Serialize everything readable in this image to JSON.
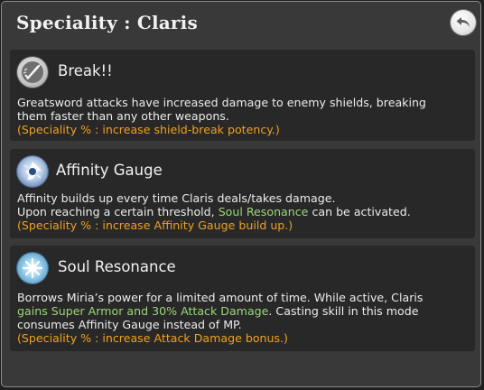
{
  "header": {
    "title": "Speciality : Claris",
    "back_icon": "undo-arrow-icon"
  },
  "skills": [
    {
      "name": "Break!!",
      "icon": "sword-strike-icon",
      "desc_line1": "Greatsword attacks have increased damage to enemy shields, breaking",
      "desc_line2": "them faster than any other weapons.",
      "bonus": "(Speciality % : increase shield-break potency.)"
    },
    {
      "name": "Affinity Gauge",
      "icon": "affinity-spirit-icon",
      "desc_line1": "Affinity builds up every time Claris deals/takes damage.",
      "desc_line2_pre": "Upon reaching a certain threshold, ",
      "desc_line2_highlight": "Soul Resonance",
      "desc_line2_post": " can be activated.",
      "bonus": "(Speciality % : increase Affinity Gauge build up.)"
    },
    {
      "name": "Soul Resonance",
      "icon": "soul-burst-icon",
      "desc_line1": "Borrows Miria’s power for a limited amount of time. While active, Claris",
      "desc_line2_highlight": "gains Super Armor and 30% Attack Damage",
      "desc_line2_post": ". Casting skill in this mode",
      "desc_line3": "consumes Affinity Gauge instead of MP.",
      "bonus": "(Speciality % : increase Attack Damage bonus.)"
    }
  ],
  "colors": {
    "panel": "#393939",
    "card": "#282828",
    "highlight_green": "#9cd67a",
    "bonus_orange": "#f0a020"
  }
}
